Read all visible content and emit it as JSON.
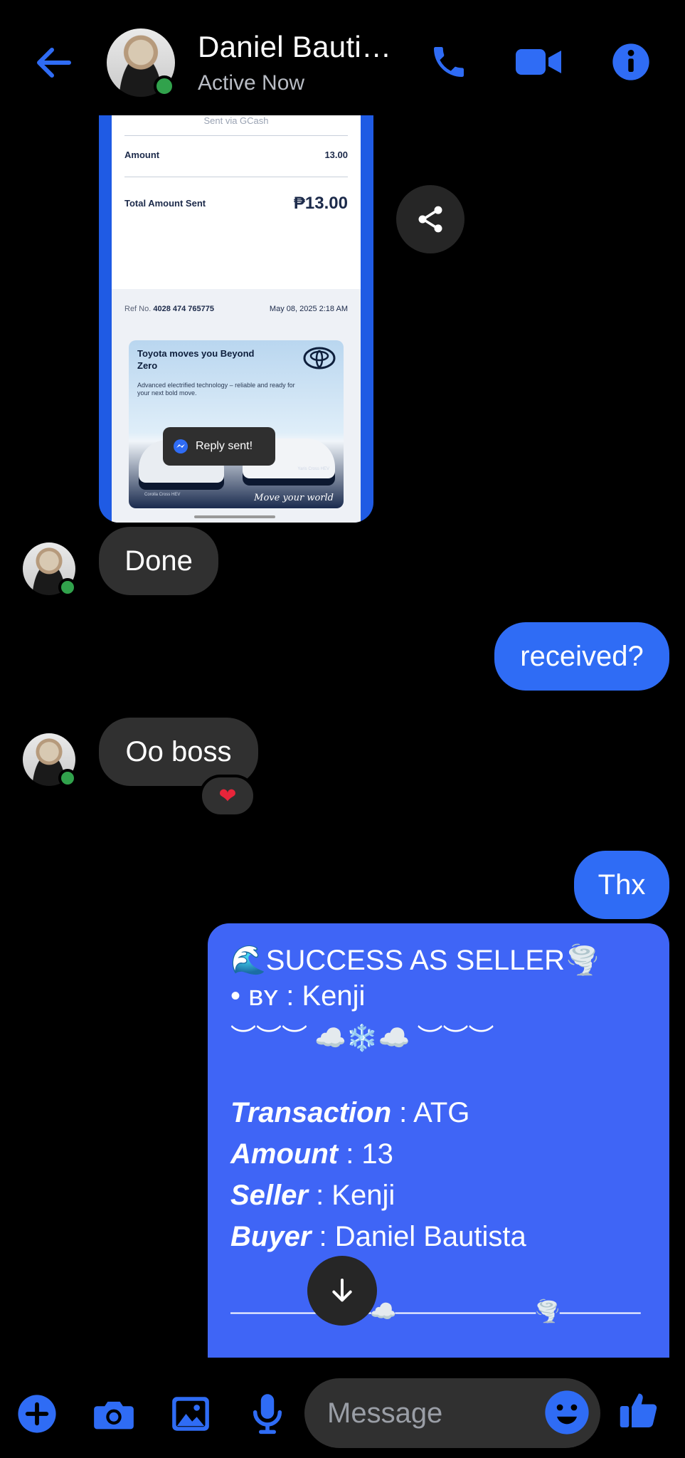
{
  "colors": {
    "accent": "#2f6cf5",
    "incoming_bubble": "#303030",
    "presence": "#31a24c",
    "seller_card": "#3f65f6"
  },
  "header": {
    "contact_name": "Daniel Bauti…",
    "status": "Active Now",
    "icons": [
      "back-arrow-icon",
      "phone-icon",
      "video-icon",
      "info-icon"
    ]
  },
  "attachment": {
    "receipt": {
      "top_text": "Sent via GCash",
      "amount_label": "Amount",
      "amount_value": "13.00",
      "total_label": "Total Amount Sent",
      "total_value": "₱13.00",
      "ref_label": "Ref No.",
      "ref_value": "4028 474 765775",
      "date": "May 08, 2025 2:18 AM"
    },
    "ad": {
      "headline": "Toyota moves you Beyond Zero",
      "subline": "Advanced electrified technology – reliable and ready for your next bold move.",
      "car_left": "Corolla Cross HEV",
      "car_right": "Yaris Cross HEV",
      "tagline": "Move your world"
    },
    "toast": "Reply sent!"
  },
  "messages": [
    {
      "direction": "in",
      "text": "Done"
    },
    {
      "direction": "out",
      "text": "received?"
    },
    {
      "direction": "in",
      "text": "Oo boss",
      "reaction": "❤"
    },
    {
      "direction": "out",
      "text": "Thx"
    }
  ],
  "seller_card": {
    "title": "🌊SUCCESS AS SELLER🌪️",
    "by_label": "• ʙʏ",
    "by_value": " : Kenji",
    "divider": "︶︶︶ ☁️❄️☁️ ︶︶︶",
    "transaction_label": "Transaction",
    "transaction_value": " : ATG",
    "amount_label": "Amount",
    "amount_value": " : 13",
    "seller_label": "Seller",
    "seller_value": " : Kenji",
    "buyer_label": "Buyer",
    "buyer_value": " : Daniel Bautista",
    "footer_divider": "———————☁️———————🌪️————"
  },
  "composer": {
    "placeholder": "Message",
    "icons": [
      "plus-icon",
      "camera-icon",
      "gallery-icon",
      "microphone-icon",
      "emoji-icon",
      "thumbs-up-icon"
    ]
  }
}
